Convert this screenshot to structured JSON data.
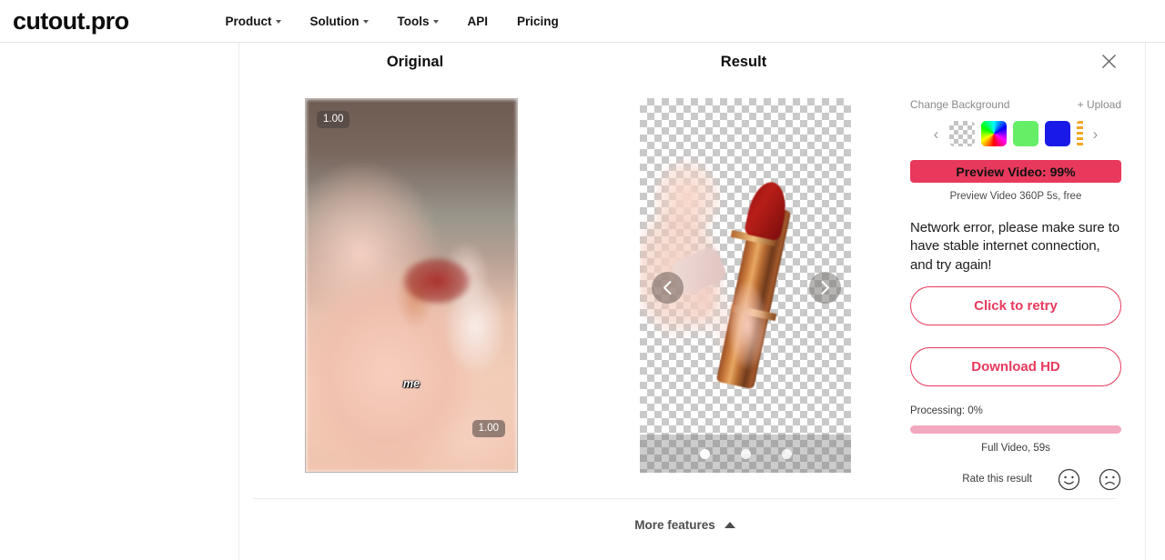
{
  "brand": {
    "logo": "cutout.pro"
  },
  "nav": {
    "items": [
      {
        "label": "Product",
        "has_caret": true
      },
      {
        "label": "Solution",
        "has_caret": true
      },
      {
        "label": "Tools",
        "has_caret": true
      },
      {
        "label": "API",
        "has_caret": false
      },
      {
        "label": "Pricing",
        "has_caret": false
      }
    ]
  },
  "panels": {
    "original_title": "Original",
    "result_title": "Result",
    "original_overlays": {
      "badge_top_left": "1.00",
      "badge_bottom_right": "1.00",
      "caption": "me"
    }
  },
  "controls": {
    "change_background_label": "Change Background",
    "upload_label": "+ Upload",
    "swatches": [
      {
        "name": "transparent",
        "color": "transparent"
      },
      {
        "name": "rainbow",
        "color": "#ff00ff"
      },
      {
        "name": "green",
        "color": "#66ee66"
      },
      {
        "name": "blue",
        "color": "#1a1ae8"
      },
      {
        "name": "orange-partial",
        "color": "#f5a623"
      }
    ],
    "preview_button": {
      "label": "Preview Video: 99%",
      "bg_color": "#e8395c",
      "text_color": "#111111"
    },
    "preview_note": "Preview Video 360P 5s, free",
    "error_message": "Network error, please make sure to have stable internet connection, and try again!",
    "retry_button": {
      "label": "Click to retry",
      "color": "#e8395c"
    },
    "download_button": {
      "label": "Download HD",
      "color": "#e8395c"
    },
    "processing_label": "Processing: 0%",
    "progress_track_color": "#f2a8be",
    "progress_percent": 0,
    "full_video_label": "Full Video, 59s",
    "rate_label": "Rate this result"
  },
  "footer": {
    "more_features_label": "More features"
  }
}
